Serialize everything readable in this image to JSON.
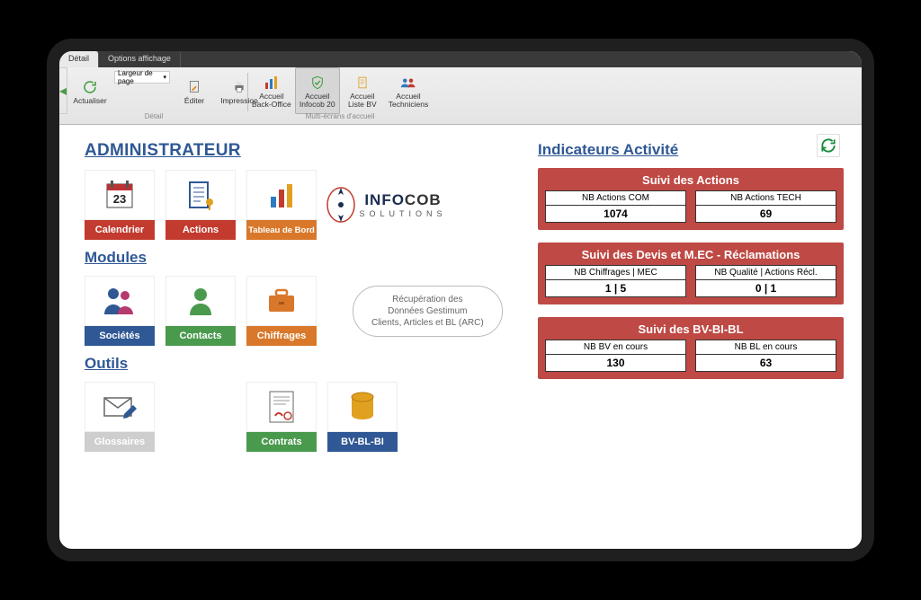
{
  "tabs": [
    "Détail",
    "Options affichage"
  ],
  "ribbon": {
    "group1_cap": "Détail",
    "group2_cap": "Multi-écrans d'accueil",
    "zoom": "Largeur de page",
    "buttons": {
      "actualiser": "Actualiser",
      "editer": "Éditer",
      "impression": "Impression",
      "back": "Accueil\nBack-Office",
      "infocob": "Accueil\nInfocob 20",
      "liste": "Accueil\nListe BV",
      "tech": "Accueil\nTechniciens"
    }
  },
  "sections": {
    "admin": "ADMINISTRATEUR",
    "modules": "Modules",
    "outils": "Outils",
    "indicators": "Indicateurs Activité"
  },
  "tiles": {
    "calendrier": "Calendrier",
    "actions": "Actions",
    "tableau": "Tableau de Bord",
    "societes": "Sociétés",
    "contacts": "Contacts",
    "chiffrages": "Chiffrages",
    "glossaires": "Glossaires",
    "contrats": "Contrats",
    "bvblbi": "BV-BL-BI"
  },
  "gray_pill": "Récupération des\nDonnées Gestimum\nClients, Articles et BL (ARC)",
  "logo": {
    "brand_left": "INFO",
    "brand_right": "COB",
    "sub": "SOLUTIONS"
  },
  "indicators": {
    "panel1": {
      "title": "Suivi des Actions",
      "cards": [
        {
          "label": "NB Actions COM",
          "value": "1074"
        },
        {
          "label": "NB Actions TECH",
          "value": "69"
        }
      ]
    },
    "panel2": {
      "title": "Suivi des Devis et M.EC - Réclamations",
      "cards": [
        {
          "label": "NB Chiffrages | MEC",
          "value": "1 | 5"
        },
        {
          "label": "NB Qualité | Actions Récl.",
          "value": "0 | 1"
        }
      ]
    },
    "panel3": {
      "title": "Suivi des BV-BI-BL",
      "cards": [
        {
          "label": "NB BV en cours",
          "value": "130"
        },
        {
          "label": "NB BL en cours",
          "value": "63"
        }
      ]
    }
  },
  "calendar_day": "23"
}
